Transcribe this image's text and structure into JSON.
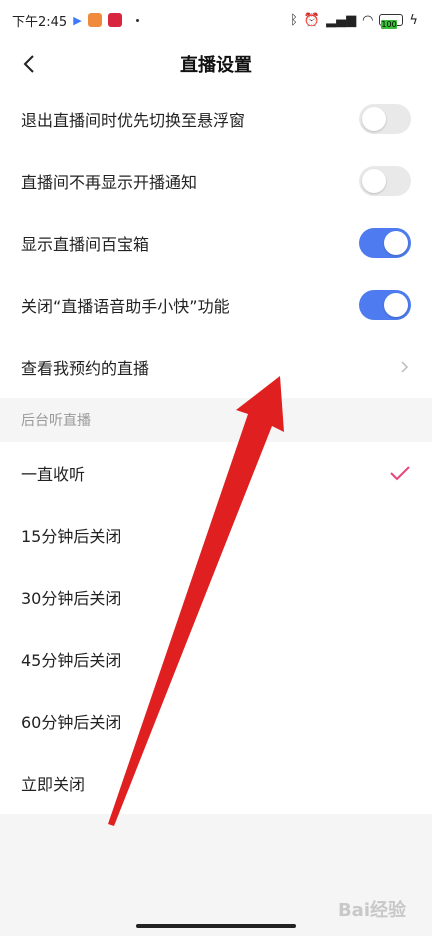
{
  "status": {
    "time": "下午2:45",
    "battery": "100"
  },
  "header": {
    "title": "直播设置"
  },
  "toggles": [
    {
      "label": "退出直播间时优先切换至悬浮窗",
      "state": "off"
    },
    {
      "label": "直播间不再显示开播通知",
      "state": "off"
    },
    {
      "label": "显示直播间百宝箱",
      "state": "on"
    },
    {
      "label": "关闭“直播语音助手小快”功能",
      "state": "on"
    }
  ],
  "link_row": {
    "label": "查看我预约的直播"
  },
  "section": {
    "title": "后台听直播"
  },
  "options": [
    {
      "label": "一直收听",
      "selected": true
    },
    {
      "label": "15分钟后关闭",
      "selected": false
    },
    {
      "label": "30分钟后关闭",
      "selected": false
    },
    {
      "label": "45分钟后关闭",
      "selected": false
    },
    {
      "label": "60分钟后关闭",
      "selected": false
    },
    {
      "label": "立即关闭",
      "selected": false
    }
  ],
  "watermark": "Bai经验",
  "colors": {
    "accent": "#4e7cf0",
    "check": "#e8457a",
    "arrow": "#e02020"
  }
}
